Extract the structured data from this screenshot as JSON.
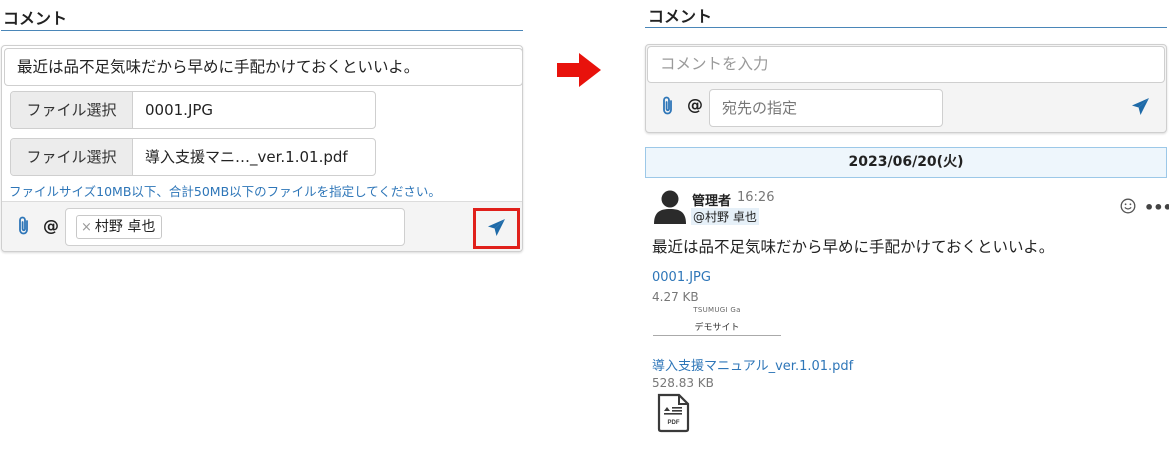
{
  "left": {
    "section_title": "コメント",
    "comment_text": "最近は品不足気味だから早めに手配かけておくといいよ。",
    "files": [
      {
        "button_label": "ファイル選択",
        "file_name": "0001.JPG"
      },
      {
        "button_label": "ファイル選択",
        "file_name": "導入支援マニ…_ver.1.01.pdf"
      }
    ],
    "hint": "ファイルサイズ10MB以下、合計50MB以下のファイルを指定してください。",
    "toolbar": {
      "at_symbol": "@",
      "recipient_chip": "村野 卓也",
      "chip_remove": "×"
    }
  },
  "right": {
    "section_title": "コメント",
    "input_placeholder": "コメントを入力",
    "toolbar": {
      "at_symbol": "@",
      "destination_placeholder": "宛先の指定"
    },
    "date_header": "2023/06/20(火)",
    "post": {
      "author": "管理者",
      "time": "16:26",
      "mention": "@村野 卓也",
      "message": "最近は品不足気味だから早めに手配かけておくといいよ。",
      "reaction_icon": "smiley-icon",
      "more_label": "•••",
      "attachments": [
        {
          "name": "0001.JPG",
          "size": "4.27 KB",
          "thumbnail_logo": "TSUMUGI Ga",
          "thumbnail_caption": "デモサイト"
        },
        {
          "name": "導入支援マニュアル_ver.1.01.pdf",
          "size": "528.83 KB",
          "icon_label": "PDF"
        }
      ]
    }
  },
  "colors": {
    "accent_blue": "#2e76b8",
    "send_icon": "#1e6aa8",
    "highlight_red": "#e0201b",
    "arrow_red": "#e8120c"
  }
}
